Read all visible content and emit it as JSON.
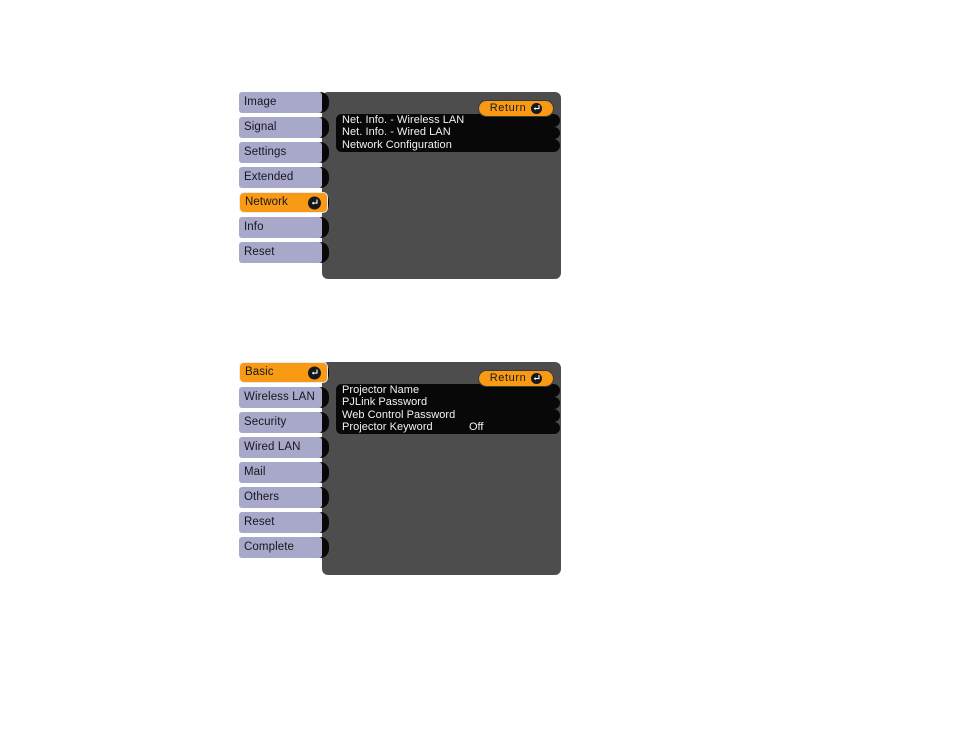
{
  "colors": {
    "panel_bg": "#4d4d4d",
    "tab_bg": "#a8a8ca",
    "tab_selected_bg": "#f89a14",
    "row_bg": "#080808",
    "row_text": "#f2f2f2",
    "page_bg": "#ffffff"
  },
  "menus": [
    {
      "id": "network-menu",
      "return_label": "Return",
      "sidebar": [
        {
          "label": "Image",
          "selected": false
        },
        {
          "label": "Signal",
          "selected": false
        },
        {
          "label": "Settings",
          "selected": false
        },
        {
          "label": "Extended",
          "selected": false
        },
        {
          "label": "Network",
          "selected": true
        },
        {
          "label": "Info",
          "selected": false
        },
        {
          "label": "Reset",
          "selected": false
        }
      ],
      "rows": [
        {
          "label": "Net. Info. - Wireless LAN",
          "value": ""
        },
        {
          "label": "Net. Info. - Wired LAN",
          "value": ""
        },
        {
          "label": "Network Configuration",
          "value": ""
        }
      ]
    },
    {
      "id": "basic-menu",
      "return_label": "Return",
      "sidebar": [
        {
          "label": "Basic",
          "selected": true
        },
        {
          "label": "Wireless LAN",
          "selected": false
        },
        {
          "label": "Security",
          "selected": false
        },
        {
          "label": "Wired LAN",
          "selected": false
        },
        {
          "label": "Mail",
          "selected": false
        },
        {
          "label": "Others",
          "selected": false
        },
        {
          "label": "Reset",
          "selected": false
        },
        {
          "label": "Complete",
          "selected": false
        }
      ],
      "rows": [
        {
          "label": "Projector Name",
          "value": ""
        },
        {
          "label": "PJLink Password",
          "value": ""
        },
        {
          "label": "Web Control Password",
          "value": ""
        },
        {
          "label": "Projector Keyword",
          "value": "Off"
        }
      ]
    }
  ],
  "icons": {
    "enter": "enter-icon"
  }
}
